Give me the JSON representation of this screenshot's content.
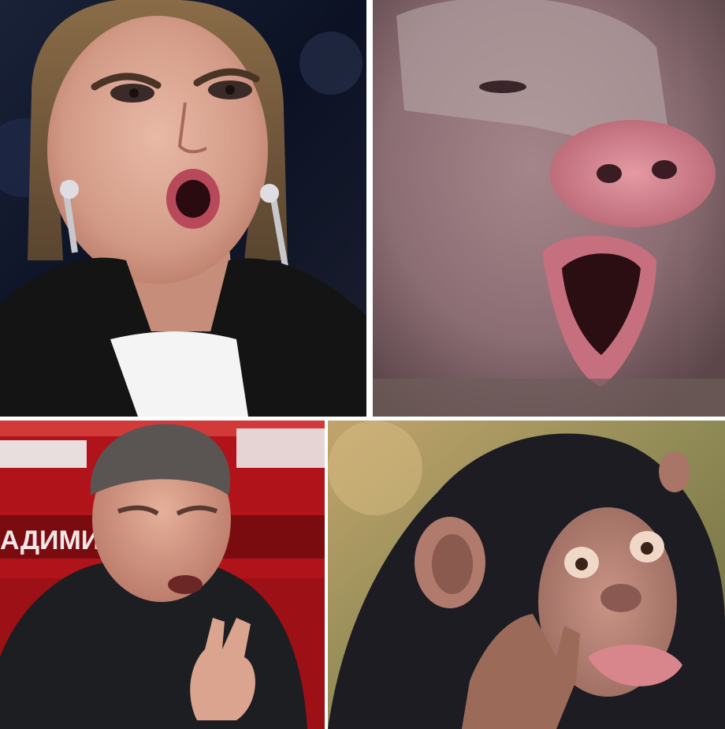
{
  "collage": {
    "panels": [
      {
        "subject": "woman-speaking"
      },
      {
        "subject": "pig-snout"
      },
      {
        "subject": "man-gesturing",
        "background_text": "АДИМИ ОЛОВЬ"
      },
      {
        "subject": "chimpanzee-gesturing"
      }
    ]
  },
  "colors": {
    "divider": "#ffffff",
    "studio_dark": "#0f1422",
    "studio_red": "#b0141a",
    "skin": "#d9a08a",
    "pig_skin": "#a67f86",
    "pig_snout": "#c7717e",
    "chimp_fur": "#1c1c22",
    "chimp_face": "#b98579",
    "foliage": "#a89460"
  }
}
